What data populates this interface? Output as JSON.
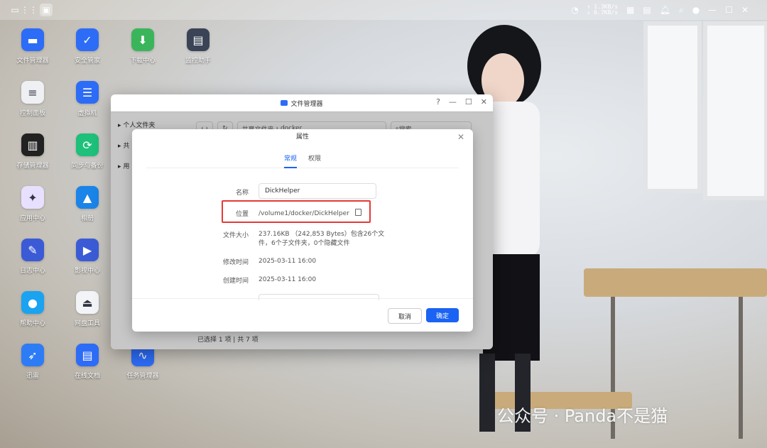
{
  "desktop_icons": [
    {
      "label": "文件管理器",
      "icon": "folder-icon",
      "color": "#2d6cf6"
    },
    {
      "label": "安全管家",
      "icon": "shield-icon",
      "color": "#2d6cf6"
    },
    {
      "label": "下载中心",
      "icon": "download-icon",
      "color": "#3bb55c"
    },
    {
      "label": "监控助手",
      "icon": "monitor-icon",
      "color": "#3a4456"
    },
    {
      "label": "控制面板",
      "icon": "sliders-icon",
      "color": "#eef0f3"
    },
    {
      "label": "虚拟机",
      "icon": "server-icon",
      "color": "#2d6cf6"
    },
    {
      "label": "存储管理器",
      "icon": "storage-icon",
      "color": "#222"
    },
    {
      "label": "同步与备份",
      "icon": "sync-icon",
      "color": "#1ec07a"
    },
    {
      "label": "应用中心",
      "icon": "apps-icon",
      "color": "#e8e0ff"
    },
    {
      "label": "相册",
      "icon": "photo-icon",
      "color": "#1a84e8"
    },
    {
      "label": "日志中心",
      "icon": "log-icon",
      "color": "#3b5bd6"
    },
    {
      "label": "影视中心",
      "icon": "video-icon",
      "color": "#3b5bd6"
    },
    {
      "label": "帮助中心",
      "icon": "bulb-icon",
      "color": "#1aa3f0"
    },
    {
      "label": "网盘工具",
      "icon": "cloud-drive-icon",
      "color": "#f2f4f8"
    },
    {
      "label": "迅雷",
      "icon": "bird-icon",
      "color": "#2d7cf6"
    },
    {
      "label": "在线文档",
      "icon": "doc-icon",
      "color": "#2d6cf6"
    },
    {
      "label": "任务管理器",
      "icon": "chart-icon",
      "color": "#2d6cf6"
    }
  ],
  "taskbar": {
    "upload_speed": "↑ 1.3KB/s",
    "download_speed": "↓ 6.7KB/s"
  },
  "file_manager": {
    "title": "文件管理器",
    "sidebar": [
      "个人文件夹",
      "共",
      "用"
    ],
    "path": [
      "共享文件夹",
      "docker"
    ],
    "search_placeholder": "搜索",
    "status": "已选择 1 项 | 共 7 项"
  },
  "dialog": {
    "title": "属性",
    "tabs": [
      "常规",
      "权限"
    ],
    "fields": {
      "name_label": "名称",
      "name_value": "DickHelper",
      "location_label": "位置",
      "location_value": "/volume1/docker/DickHelper",
      "size_label": "文件大小",
      "size_value_line1": "237.16KB （242,853 Bytes）包含26个文",
      "size_value_line2": "件，6个子文件夹，0个隐藏文件",
      "modified_label": "修改时间",
      "modified_value": "2025-03-11 16:00",
      "created_label": "创建时间",
      "created_value": "2025-03-11 16:00"
    },
    "cancel_label": "取消",
    "ok_label": "确定"
  },
  "watermark": "公众号 · Panda不是猫",
  "colors": {
    "accent": "#1a63f3",
    "highlight": "#e53935"
  }
}
